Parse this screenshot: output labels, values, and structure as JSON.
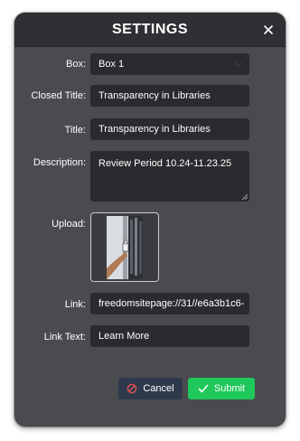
{
  "dialog": {
    "title": "SETTINGS",
    "close_icon": "close-icon"
  },
  "form": {
    "box_label": "Box:",
    "box_value": "Box 1",
    "closed_title_label": "Closed Title:",
    "closed_title_value": "Transparency in Libraries",
    "title_label": "Title:",
    "title_value": "Transparency in Libraries",
    "description_label": "Description:",
    "description_value": "Review Period 10.24-11.23.25",
    "upload_label": "Upload:",
    "link_label": "Link:",
    "link_value": "freedomsitepage://31//e6a3b1c6-",
    "link_text_label": "Link Text:",
    "link_text_value": "Learn More"
  },
  "buttons": {
    "cancel_label": "Cancel",
    "submit_label": "Submit"
  },
  "colors": {
    "dialog_bg": "#4a4b4f",
    "titlebar_bg": "#2f3034",
    "field_bg": "#2a2b2e",
    "cancel_bg": "#2e3a4c",
    "cancel_icon": "#e05252",
    "submit_bg": "#1ec85a"
  }
}
